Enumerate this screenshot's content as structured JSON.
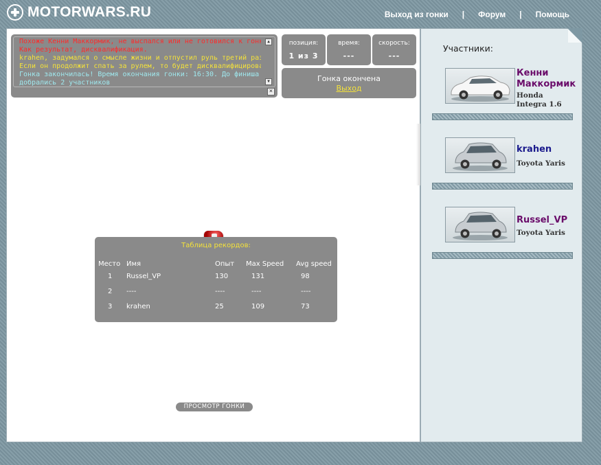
{
  "site": {
    "logo_text": "MOTORWARS.RU"
  },
  "nav": [
    {
      "label": "Выход из гонки"
    },
    {
      "label": "Форум"
    },
    {
      "label": "Помощь"
    }
  ],
  "nav_separator": "|",
  "log": {
    "lines": [
      {
        "text": "Похоже Кенни Маккормик, не выспался или не готовился к гонке...",
        "color": "#ff2a2a"
      },
      {
        "text": "Как результат, дисквалификация.",
        "color": "#ff2a2a"
      },
      {
        "text": "krahen, задумался о смысле жизни и отпустил руль третий раз.",
        "color": "#f4e23a"
      },
      {
        "text": "Если он продолжит спать за рулем, то будет дисквалифицирован.",
        "color": "#f4e23a"
      },
      {
        "text": "Гонка закончилась! Время окончания гонки: 16:30. До финиша",
        "color": "#9fe8ee"
      },
      {
        "text": "добрались 2 участников",
        "color": "#9fe8ee"
      }
    ]
  },
  "stats": {
    "position": {
      "label": "позиция:",
      "value": "1 из 3"
    },
    "time": {
      "label": "время:",
      "value": "---"
    },
    "speed": {
      "label": "скорость:",
      "value": "---"
    }
  },
  "status": {
    "text": "Гонка окончена",
    "link": "Выход"
  },
  "records": {
    "title": "Таблица рекордов:",
    "headers": [
      "Место",
      "Имя",
      "Опыт",
      "Max Speed",
      "Avg speed"
    ],
    "rows": [
      [
        "1",
        "Russel_VP",
        "130",
        "131",
        "98"
      ],
      [
        "2",
        "----",
        "----",
        "----",
        "----"
      ],
      [
        "3",
        "krahen",
        "25",
        "109",
        "73"
      ]
    ]
  },
  "replay_button": "ПРОСМОТР ГОНКИ",
  "participants": {
    "title": "Участники:",
    "items": [
      {
        "name_line1": "Кенни",
        "name_line2": "Маккормик",
        "car_line1": "Honda",
        "car_line2": "Integra 1.6",
        "name_color": "#6a0c6a",
        "car_color": "white"
      },
      {
        "name_line1": "krahen",
        "name_line2": "",
        "car_line1": "Toyota Yaris",
        "car_line2": "",
        "name_color": "#1a1a8c",
        "car_color": "silver"
      },
      {
        "name_line1": "Russel_VP",
        "name_line2": "",
        "car_line1": "Toyota Yaris",
        "car_line2": "",
        "name_color": "#6a0c6a",
        "car_color": "silver"
      }
    ]
  }
}
